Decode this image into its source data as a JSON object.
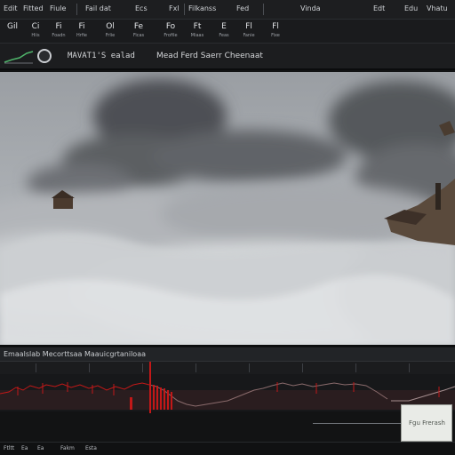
{
  "menubar": {
    "items": [
      "Edit",
      "Fitted",
      "Fiule",
      "Fail dat",
      "Ecs",
      "Fxl",
      "Filkanss",
      "Fed",
      "Vinda",
      "Edt",
      "Edu",
      "Vhatu"
    ]
  },
  "toolbar": {
    "tools": [
      {
        "glyph": "Gil",
        "label": ""
      },
      {
        "glyph": "Ci",
        "label": "Hiis"
      },
      {
        "glyph": "Fi",
        "label": "Foadn"
      },
      {
        "glyph": "Fi",
        "label": "Hrfie"
      },
      {
        "glyph": "Ol",
        "label": "Frlie"
      },
      {
        "glyph": "Fe",
        "label": "Ficas"
      },
      {
        "glyph": "Fo",
        "label": "Frofile"
      },
      {
        "glyph": "Ft",
        "label": "Miaas"
      },
      {
        "glyph": "E",
        "label": "Feas"
      },
      {
        "glyph": "Fl",
        "label": "Fanie"
      },
      {
        "glyph": "Fl",
        "label": "Fixe"
      }
    ]
  },
  "options": {
    "field_left": "MAVAT1'S ealad",
    "field_right": "Mead Ferd Saerr Cheenaat"
  },
  "timeline": {
    "title": "Emaalslab Mecorttsaa Maauicgrtaniloaa",
    "tooltip": "Fgu Frerash"
  },
  "statusbar": {
    "items": [
      "Ftltt",
      "Ea",
      "Ea",
      "Fakm",
      "Esta"
    ]
  },
  "colors": {
    "panel": "#1d1e20",
    "keyframe_red": "#c21818",
    "sky": "#8d9196",
    "tooltip_bg": "#e9ebe7"
  },
  "icons": [
    "graph-icon",
    "record-circle-icon"
  ]
}
